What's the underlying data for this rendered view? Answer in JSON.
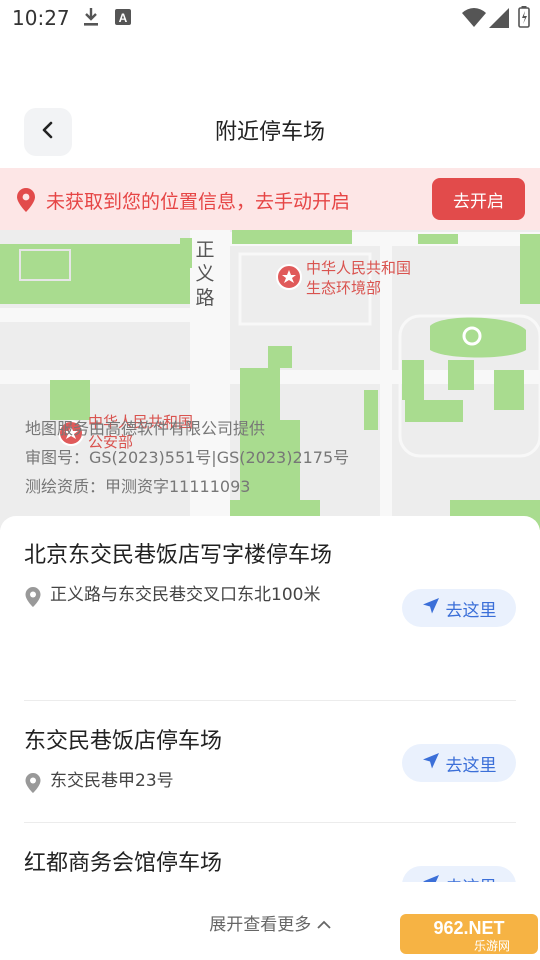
{
  "status_bar": {
    "time": "10:27",
    "icons": [
      "download-icon",
      "font-a-icon",
      "wifi-icon",
      "signal-icon",
      "battery-icon"
    ]
  },
  "header": {
    "title": "附近停车场",
    "back_icon": "chevron-left-icon"
  },
  "location_notice": {
    "message": "未获取到您的位置信息，去手动开启",
    "button_label": "去开启",
    "icon": "location-pin-icon",
    "color": "#e24b4b"
  },
  "map": {
    "road_label": "正义路",
    "pois": [
      {
        "name_line1": "中华人民共和国",
        "name_line2": "生态环境部"
      },
      {
        "name_line1": "中华人民共和国",
        "name_line2": "公安部"
      }
    ],
    "credits": [
      "地图服务由高德软件有限公司提供",
      "审图号：GS(2023)551号|GS(2023)2175号",
      "测绘资质：甲测资字11111093"
    ]
  },
  "parking_list": [
    {
      "name": "北京东交民巷饭店写字楼停车场",
      "address": "正义路与东交民巷交叉口东北100米",
      "button_label": "去这里"
    },
    {
      "name": "东交民巷饭店停车场",
      "address": "东交民巷甲23号",
      "button_label": "去这里"
    },
    {
      "name": "红都商务会馆停车场",
      "address": "",
      "button_label": "去这里"
    }
  ],
  "show_more": "展开查看更多",
  "watermark": {
    "line1": "962.NET",
    "line2": "乐游网"
  },
  "colors": {
    "accent_blue": "#3b6fd8",
    "alert_red": "#e24b4b"
  }
}
